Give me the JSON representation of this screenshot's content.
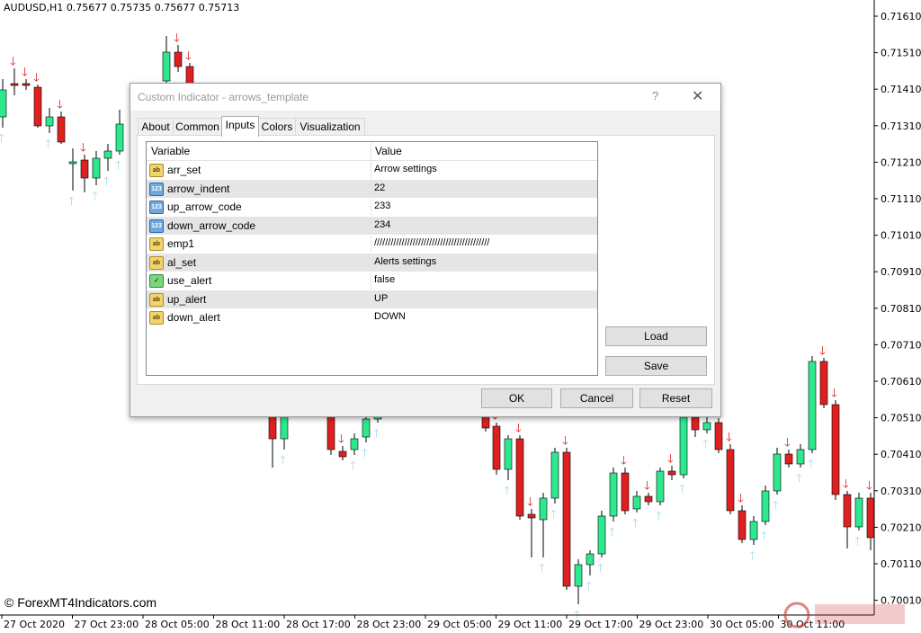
{
  "chart": {
    "symbol_label": "AUDUSD,H1  0.75677  0.75735  0.75677  0.75713",
    "price_axis": [
      "0.71610",
      "0.71510",
      "0.71410",
      "0.71310",
      "0.71210",
      "0.71110",
      "0.71010",
      "0.70910",
      "0.70810",
      "0.70710",
      "0.70610",
      "0.70510",
      "0.70410",
      "0.70310",
      "0.70210",
      "0.70110",
      "0.70010"
    ],
    "time_axis": [
      "27 Oct 2020",
      "27 Oct 23:00",
      "28 Oct 05:00",
      "28 Oct 11:00",
      "28 Oct 17:00",
      "28 Oct 23:00",
      "29 Oct 05:00",
      "29 Oct 11:00",
      "29 Oct 17:00",
      "29 Oct 23:00",
      "30 Oct 05:00",
      "30 Oct 11:00"
    ],
    "watermark": "© ForexMT4Indicators.com",
    "colors": {
      "bull": "#2ee88f",
      "bear": "#e02020",
      "up_arrow": "#a8d8ee",
      "down_arrow": "#dd1b1b"
    }
  },
  "dialog": {
    "title": "Custom Indicator - arrows_template",
    "help": "?",
    "close": "✕",
    "tabs": [
      "About",
      "Common",
      "Inputs",
      "Colors",
      "Visualization"
    ],
    "active_tab": "Inputs",
    "columns": {
      "variable": "Variable",
      "value": "Value"
    },
    "rows": [
      {
        "icon": "ab",
        "name": "arr_set",
        "value": "Arrow settings"
      },
      {
        "icon": "123",
        "name": "arrow_indent",
        "value": "22"
      },
      {
        "icon": "123",
        "name": "up_arrow_code",
        "value": "233"
      },
      {
        "icon": "123",
        "name": "down_arrow_code",
        "value": "234"
      },
      {
        "icon": "ab",
        "name": "emp1",
        "value": "//////////////////////////////////////////"
      },
      {
        "icon": "ab",
        "name": "al_set",
        "value": "Alerts settings"
      },
      {
        "icon": "bool",
        "name": "use_alert",
        "value": "false"
      },
      {
        "icon": "ab",
        "name": "up_alert",
        "value": "UP"
      },
      {
        "icon": "ab",
        "name": "down_alert",
        "value": "DOWN"
      }
    ],
    "buttons": {
      "load": "Load",
      "save": "Save",
      "ok": "OK",
      "cancel": "Cancel",
      "reset": "Reset"
    }
  }
}
